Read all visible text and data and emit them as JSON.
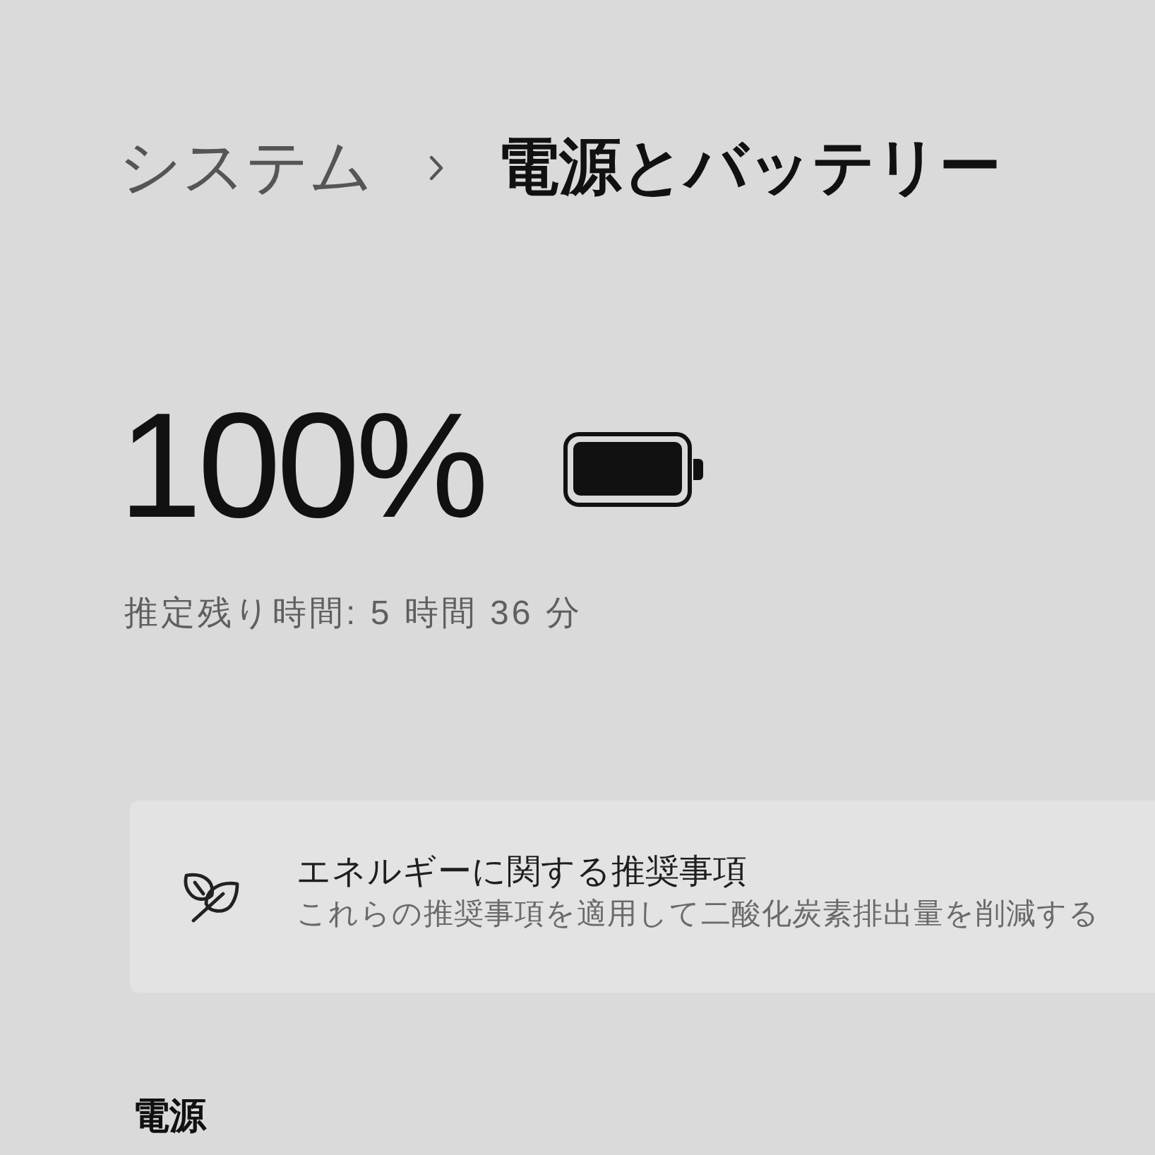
{
  "breadcrumb": {
    "parent": "システム",
    "current": "電源とバッテリー"
  },
  "battery": {
    "percent": "100%",
    "level": 1,
    "estimate": "推定残り時間: 5 時間 36 分"
  },
  "recommendations_card": {
    "title": "エネルギーに関する推奨事項",
    "description": "これらの推奨事項を適用して二酸化炭素排出量を削減する"
  },
  "power_section": {
    "heading": "電源"
  }
}
